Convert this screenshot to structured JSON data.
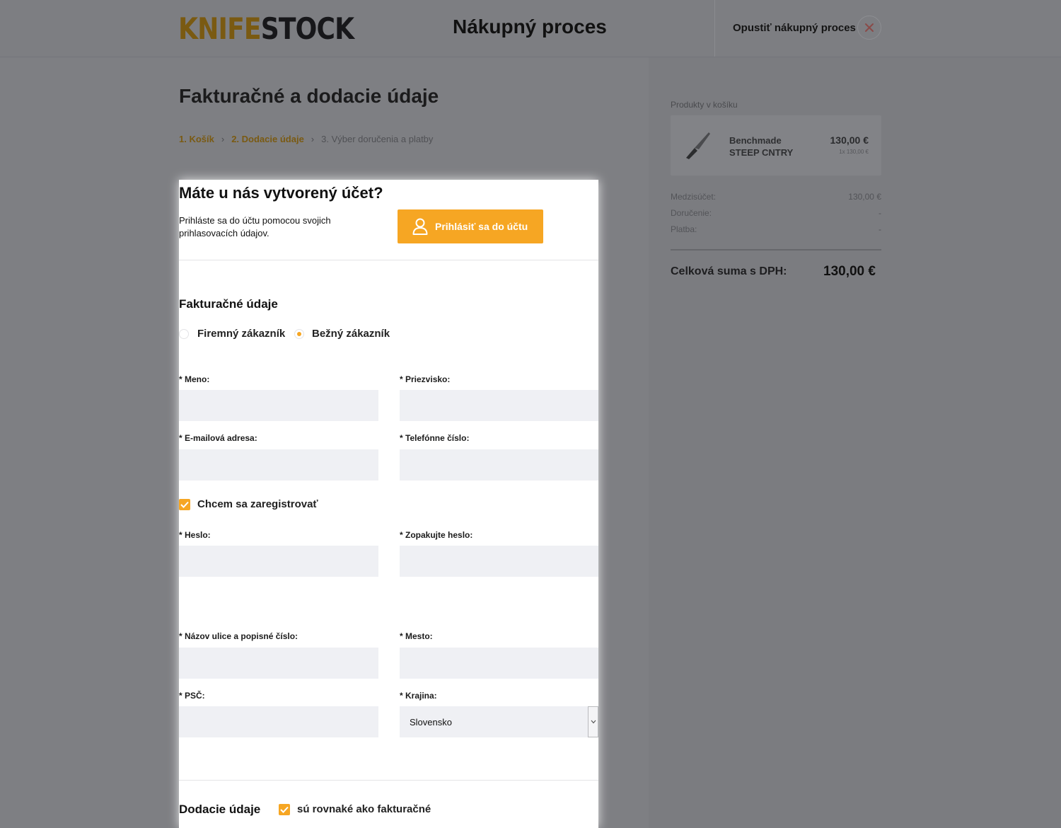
{
  "header": {
    "logo_part1": "KNIFE",
    "logo_part2": "STOCK",
    "title": "Nákupný proces",
    "exit_label": "Opustiť nákupný proces"
  },
  "page": {
    "title": "Fakturačné a dodacie údaje",
    "breadcrumb": [
      {
        "label": "1.  Košík"
      },
      {
        "label": "2.  Dodacie údaje"
      },
      {
        "label": "3.  Výber doručenia a platby"
      }
    ]
  },
  "account": {
    "title": "Máte u nás vytvorený účet?",
    "description": "Prihláste sa do účtu pomocou svojich prihlasovacích údajov.",
    "login_button": "Prihlásiť sa do účtu"
  },
  "billing": {
    "title": "Fakturačné údaje",
    "customer_types": [
      {
        "label": "Firemný zákazník",
        "selected": false
      },
      {
        "label": "Bežný zákazník",
        "selected": true
      }
    ],
    "fields": {
      "first_name": "* Meno:",
      "last_name": "* Priezvisko:",
      "email": "* E-mailová adresa:",
      "phone": "* Telefónne číslo:",
      "register": "Chcem sa zaregistrovať",
      "password": "* Heslo:",
      "password_repeat": "* Zopakujte heslo:",
      "street": "* Názov ulice a popisné číslo:",
      "city": "* Mesto:",
      "zip": "* PSČ:",
      "country": "* Krajina:"
    },
    "country_value": "Slovensko"
  },
  "delivery": {
    "title": "Dodacie údaje",
    "same_as_billing": "sú rovnaké ako fakturačné"
  },
  "cart": {
    "title": "Produkty v košíku",
    "product": {
      "name_line1": "Benchmade",
      "name_line2": "STEEP CNTRY",
      "price": "130,00 €",
      "unit": "1x 130,00 €"
    },
    "summary": [
      {
        "label": "Medzisúčet:",
        "value": "130,00 €"
      },
      {
        "label": "Doručenie:",
        "value": "-"
      },
      {
        "label": "Platba:",
        "value": "-"
      }
    ],
    "total_label": "Celková suma s DPH:",
    "total_value": "130,00 €"
  },
  "colors": {
    "accent": "#f6a623",
    "input_bg": "#eff0f4",
    "overlay_gray": "#7e7f83"
  }
}
